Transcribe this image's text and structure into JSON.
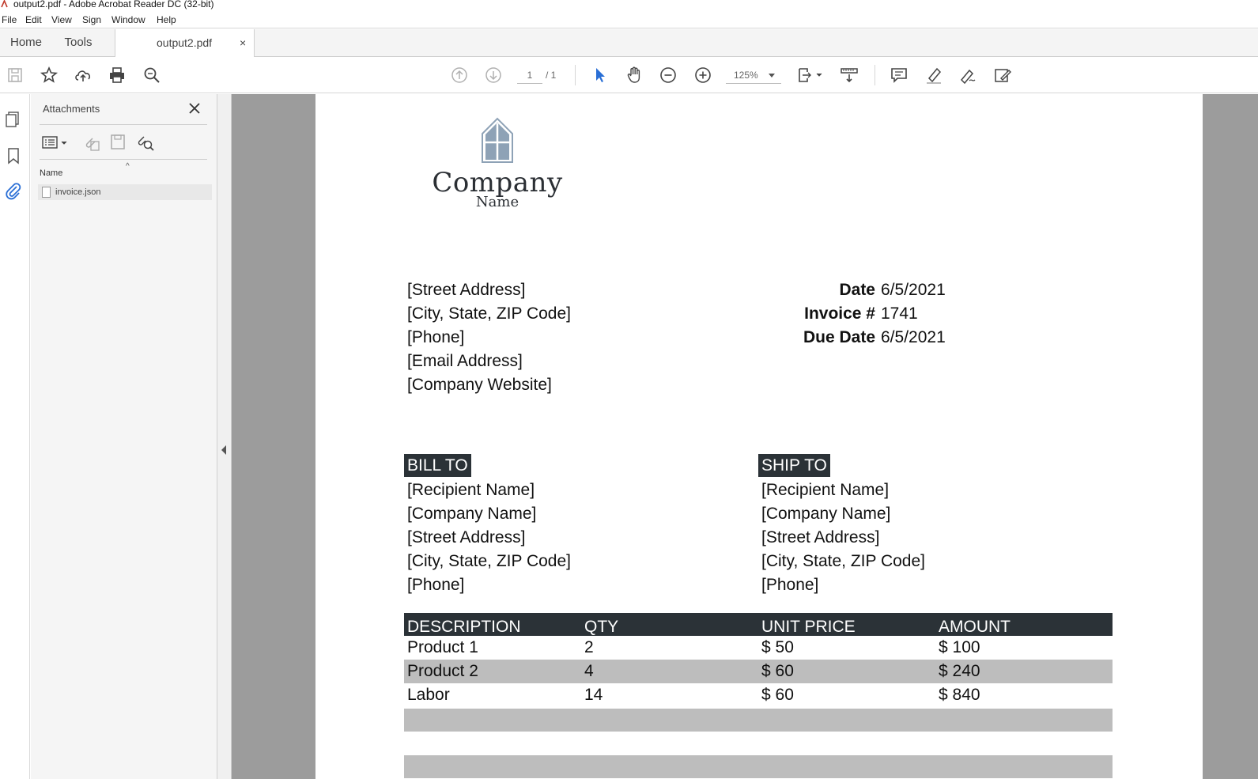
{
  "window": {
    "title": "output2.pdf - Adobe Acrobat Reader DC (32-bit)"
  },
  "menu": [
    "File",
    "Edit",
    "View",
    "Sign",
    "Window",
    "Help"
  ],
  "tabs": {
    "home": "Home",
    "tools": "Tools",
    "document": "output2.pdf",
    "close": "×"
  },
  "toolbar": {
    "page_current": "1",
    "page_total": "/ 1",
    "zoom": "125%",
    "icons": [
      "save-icon",
      "bookmark-star-icon",
      "upload-cloud-icon",
      "print-icon",
      "search-zoom-icon",
      "prev-page-icon",
      "next-page-icon",
      "select-arrow-icon",
      "hand-icon",
      "zoom-out-icon",
      "zoom-in-icon",
      "page-fit-icon",
      "scroll-mode-icon",
      "comment-icon",
      "highlight-icon",
      "sign-icon",
      "edit-pdf-icon"
    ]
  },
  "attachments": {
    "title": "Attachments",
    "column_name": "Name",
    "files": [
      {
        "name": "invoice.json"
      }
    ]
  },
  "invoice": {
    "logo": {
      "company": "Company",
      "name": "Name"
    },
    "sender": [
      "[Street Address]",
      "[City, State, ZIP Code]",
      "[Phone]",
      "[Email Address]",
      "[Company Website]"
    ],
    "meta": [
      {
        "label": "Date",
        "value": "6/5/2021"
      },
      {
        "label": "Invoice #",
        "value": "1741"
      },
      {
        "label": "Due Date",
        "value": "6/5/2021"
      }
    ],
    "bill_to": {
      "heading": "BILL TO",
      "lines": [
        "[Recipient Name]",
        "[Company Name]",
        "[Street Address]",
        "[City, State, ZIP Code]",
        "[Phone]"
      ]
    },
    "ship_to": {
      "heading": "SHIP TO",
      "lines": [
        "[Recipient Name]",
        "[Company Name]",
        "[Street Address]",
        "[City, State, ZIP Code]",
        "[Phone]"
      ]
    },
    "items": {
      "headers": [
        "DESCRIPTION",
        "QTY",
        "UNIT PRICE",
        "AMOUNT"
      ],
      "rows": [
        [
          "Product 1",
          "2",
          "$ 50",
          "$ 100"
        ],
        [
          "Product 2",
          "4",
          "$ 60",
          "$ 240"
        ],
        [
          "Labor",
          "14",
          "$ 60",
          "$ 840"
        ]
      ]
    }
  },
  "colors": {
    "accent": "#2b3237",
    "shade": "#bdbdbd",
    "canvas": "#9c9c9c",
    "select_blue": "#2a6fd6"
  }
}
